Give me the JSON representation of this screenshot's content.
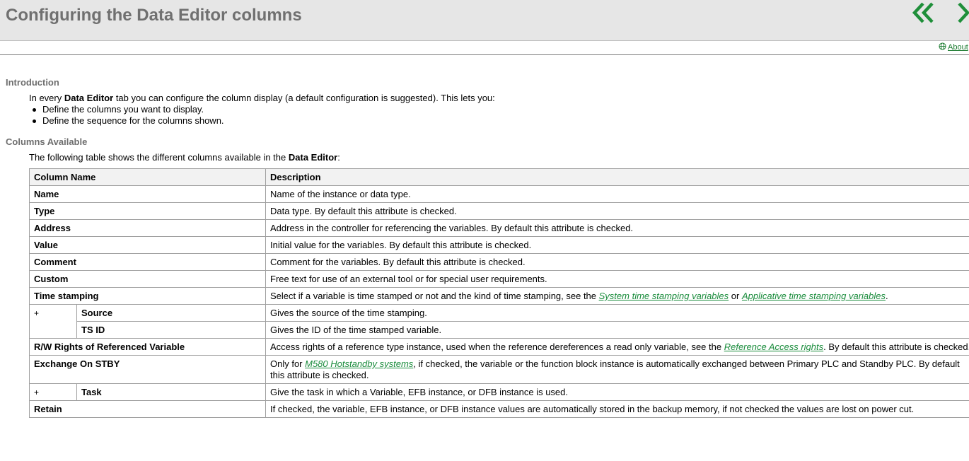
{
  "header": {
    "title": "Configuring the Data Editor columns",
    "accent_color": "#1f8f3a",
    "prev_icon": "double-chevron-left-icon",
    "next_icon": "chevron-right-icon"
  },
  "about": {
    "label": "About"
  },
  "intro": {
    "heading": "Introduction",
    "text_before": "In every ",
    "text_bold": "Data Editor",
    "text_after": " tab you can configure the column display (a default configuration is suggested). This lets you:",
    "bullets": [
      "Define the columns you want to display.",
      "Define the sequence for the columns shown."
    ]
  },
  "columns": {
    "heading": "Columns Available",
    "text_before": "The following table shows the different columns available in the ",
    "text_bold": "Data Editor",
    "text_after": ":",
    "table": {
      "header": [
        "Column Name",
        "Description"
      ],
      "rows": {
        "name": {
          "name": "Name",
          "desc": "Name of the instance or data type."
        },
        "type": {
          "name": "Type",
          "desc": "Data type. By default this attribute is checked."
        },
        "address": {
          "name": "Address",
          "desc": "Address in the controller for referencing the variables. By default this attribute is checked."
        },
        "value": {
          "name": "Value",
          "desc": "Initial value for the variables. By default this attribute is checked."
        },
        "comment": {
          "name": "Comment",
          "desc": "Comment for the variables. By default this attribute is checked."
        },
        "custom": {
          "name": "Custom",
          "desc": "Free text for use of an external tool or for special user requirements."
        },
        "timestamp": {
          "name": "Time stamping",
          "desc_before": "Select if a variable is time stamped or not and the kind of time stamping, see the ",
          "link1": "System time stamping variables",
          "desc_mid": " or ",
          "link2": "Applicative time stamping variables",
          "desc_after": "."
        },
        "ts_expand": "+",
        "source": {
          "name": "Source",
          "desc": "Gives the source of the time stamping."
        },
        "tsid": {
          "name": "TS ID",
          "desc": "Gives the ID of the time stamped variable."
        },
        "rw": {
          "name": "R/W Rights of Referenced Variable",
          "desc_before": "Access rights of a reference type instance, used when the reference dereferences a read only variable, see the ",
          "link": "Reference Access rights",
          "desc_after": ". By default this attribute is checked."
        },
        "stby": {
          "name": "Exchange On STBY",
          "desc_before": "Only for ",
          "link": "M580 Hotstandby systems",
          "desc_after": ", if checked, the variable or the function block instance is automatically exchanged between Primary PLC and Standby PLC. By default this attribute is checked."
        },
        "task_expand": "+",
        "task": {
          "name": "Task",
          "desc": "Give the task in which a Variable, EFB instance, or DFB instance is used."
        },
        "retain": {
          "name": "Retain",
          "desc": "If checked, the variable, EFB instance, or DFB instance values are automatically stored in the backup memory, if not checked the values are lost on power cut."
        }
      }
    }
  }
}
